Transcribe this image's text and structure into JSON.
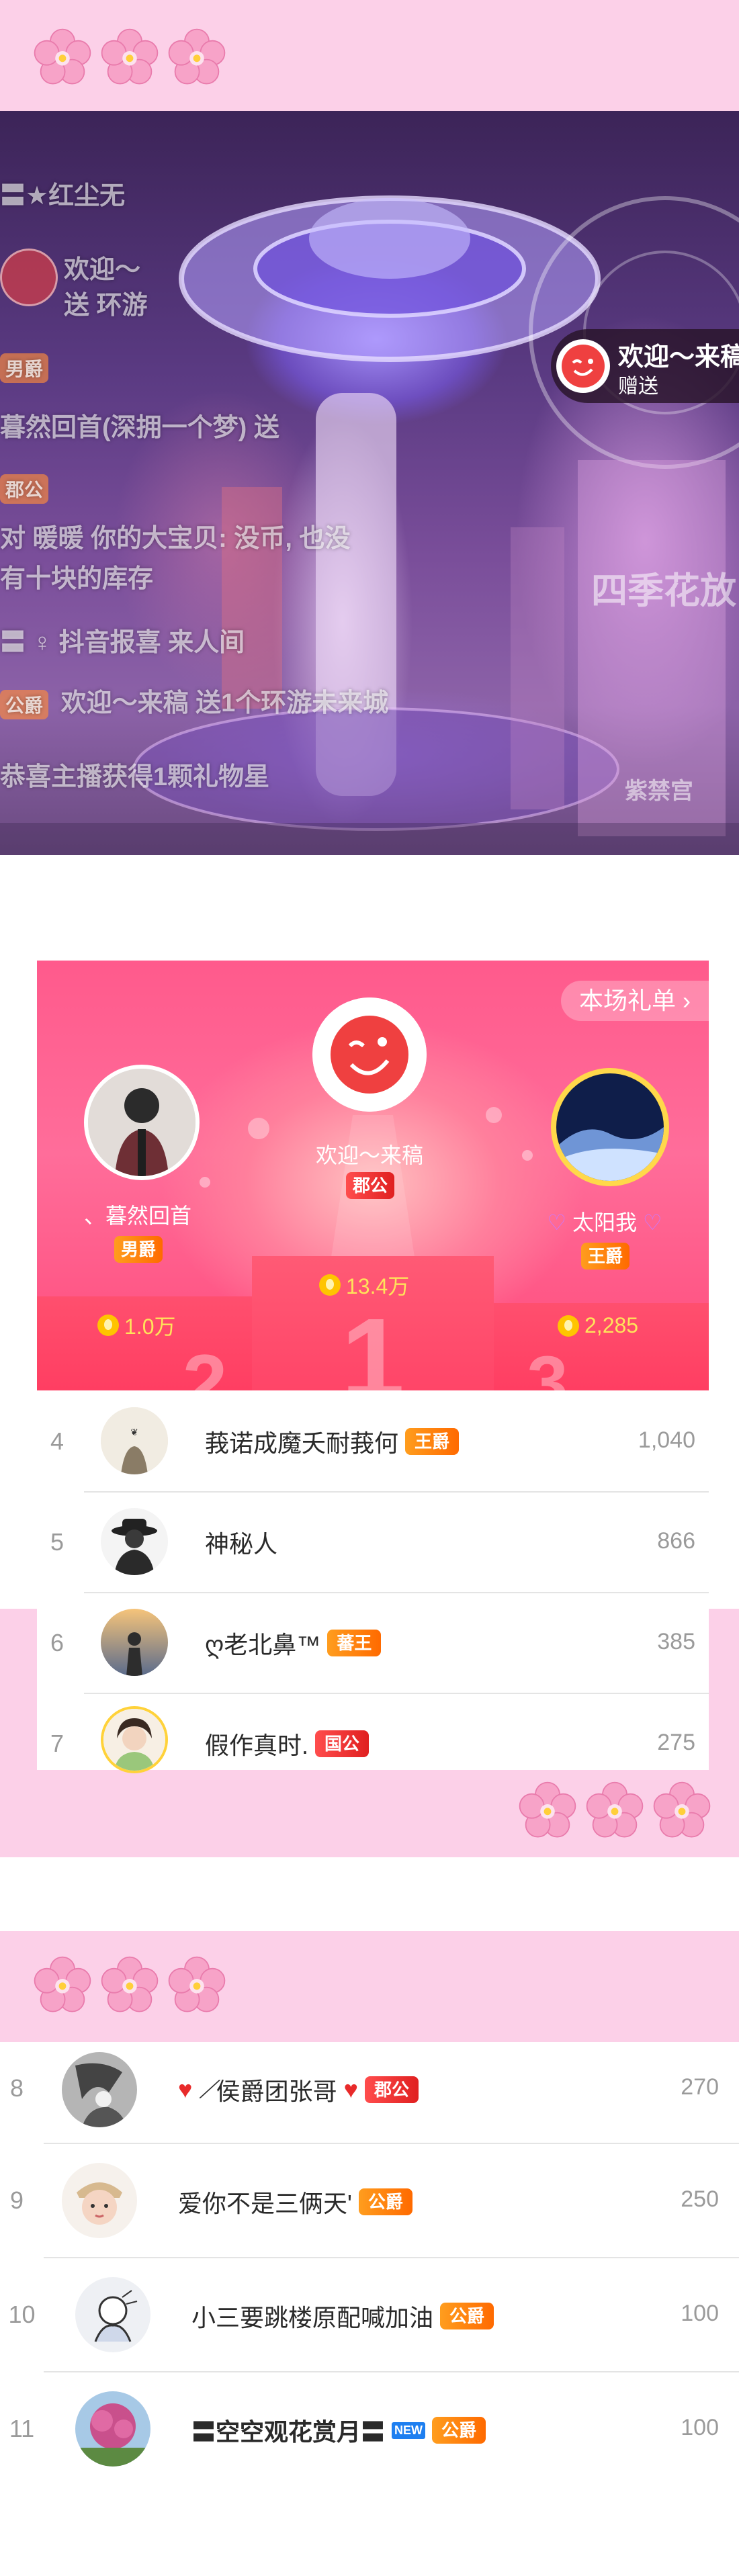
{
  "video": {
    "chat_lines": [
      "〓★红尘无",
      "欢迎～",
      "送 环游",
      "暮然回首(深拥一个梦) 送",
      "对 暖暖    你的大宝贝: 没币, 也没",
      "有十块的库存",
      "〓  ♀  抖音报喜  来人间",
      "欢迎～来稿 送1个环游未来城",
      "恭喜主播获得1颗礼物星"
    ],
    "chat_badges": [
      "男爵",
      "郡公",
      "公爵"
    ],
    "toast": {
      "title": "欢迎～来稿",
      "subtitle": "赠送"
    },
    "deco_texts": [
      "四季花放",
      "紫禁宫"
    ]
  },
  "podium": {
    "gift_list_button": "本场礼单",
    "first": {
      "name": "欢迎～来稿",
      "badge": "郡公",
      "value": "13.4万",
      "rank": "1"
    },
    "second": {
      "name": "、暮然回首",
      "badge": "男爵",
      "value": "1.0万",
      "rank": "2"
    },
    "third": {
      "name": "太阳我",
      "badge": "王爵",
      "value": "2,285",
      "rank": "3"
    }
  },
  "ranking": [
    {
      "rank": "4",
      "name": "莪诺成魔夭耐莪何",
      "badge": "王爵",
      "value": "1,040"
    },
    {
      "rank": "5",
      "name": "神秘人",
      "badge": "",
      "value": "866"
    },
    {
      "rank": "6",
      "name": "ღ老北鼻™",
      "badge": "蕃王",
      "value": "385"
    },
    {
      "rank": "7",
      "name": "假作真时.",
      "badge": "国公",
      "value": "275"
    },
    {
      "rank": "8",
      "name": "侯爵团张哥",
      "badge": "郡公",
      "value": "270"
    },
    {
      "rank": "9",
      "name": "爱你不是三俩天'",
      "badge": "公爵",
      "value": "250"
    },
    {
      "rank": "10",
      "name": "小三要跳楼原配喊加油",
      "badge": "公爵",
      "value": "100"
    },
    {
      "rank": "11",
      "name": "〓空空观花赏月〓",
      "new_tag": "NEW",
      "badge": "公爵",
      "value": "100"
    }
  ],
  "colors": {
    "band": "#fcd0e8",
    "podium": "#ff5a8c",
    "badge_orange": "#ff8a10",
    "badge_red": "#e82a2a"
  }
}
